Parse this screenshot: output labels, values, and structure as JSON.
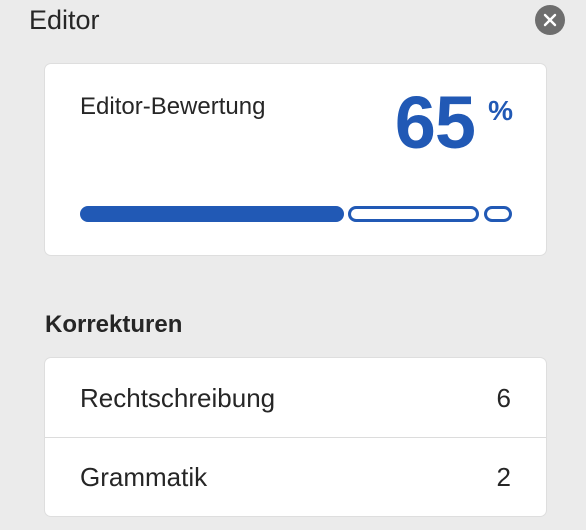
{
  "header": {
    "title": "Editor"
  },
  "score": {
    "label": "Editor-Bewertung",
    "value": "65",
    "unit": "%",
    "fill_fraction": 0.65
  },
  "corrections": {
    "title": "Korrekturen",
    "items": [
      {
        "label": "Rechtschreibung",
        "count": "6"
      },
      {
        "label": "Grammatik",
        "count": "2"
      }
    ]
  },
  "colors": {
    "accent": "#2159b5",
    "background": "#ebebeb",
    "card": "#ffffff",
    "close_button": "#6e6e6e"
  },
  "icons": {
    "close": "close-icon"
  }
}
